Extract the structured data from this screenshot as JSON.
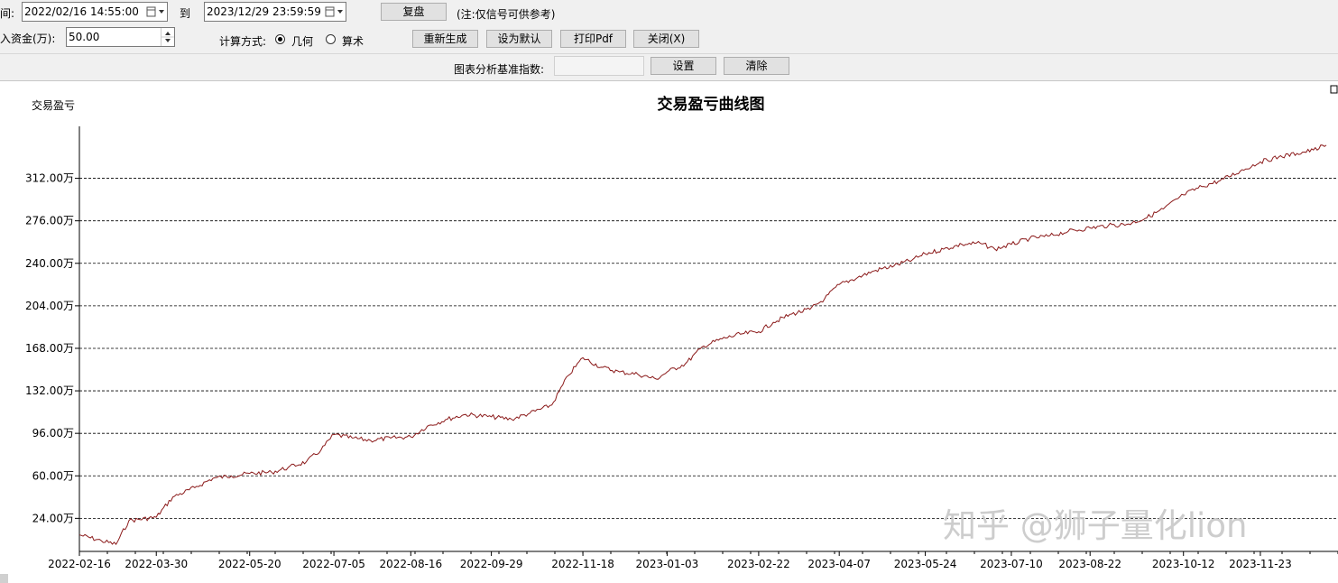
{
  "controls": {
    "time_label": "间:",
    "start_date": "2022/02/16 14:55:00",
    "to_label": "到",
    "end_date": "2023/12/29 23:59:59",
    "replay_button": "复盘",
    "note": "(注:仅信号可供参考)",
    "capital_label": "入资金(万):",
    "capital_value": "50.00",
    "calc_label": "计算方式:",
    "calc_options": [
      {
        "label": "几何",
        "selected": true
      },
      {
        "label": "算术",
        "selected": false
      }
    ],
    "regenerate_button": "重新生成",
    "set_default_button": "设为默认",
    "print_pdf_button": "打印Pdf",
    "close_button": "关闭(X)",
    "index_label": "图表分析基准指数:",
    "index_value": "",
    "set_button": "设置",
    "clear_button": "清除"
  },
  "watermark": "知乎 @狮子量化lion",
  "chart_data": {
    "type": "line",
    "title": "交易盈亏曲线图",
    "ylabel": "交易盈亏",
    "xlabel": "",
    "ylim": [
      -4,
      356
    ],
    "yticks": [
      24,
      60,
      96,
      132,
      168,
      204,
      240,
      276,
      312
    ],
    "ytick_labels": [
      "24.00万",
      "60.00万",
      "96.00万",
      "132.00万",
      "168.00万",
      "204.00万",
      "240.00万",
      "276.00万",
      "312.00万"
    ],
    "xticks": [
      "2022-02-16",
      "2022-03-30",
      "2022-05-20",
      "2022-07-05",
      "2022-08-16",
      "2022-09-29",
      "2022-11-18",
      "2023-01-03",
      "2023-02-22",
      "2023-04-07",
      "2023-05-24",
      "2023-07-10",
      "2023-08-22",
      "2023-10-12",
      "2023-11-23"
    ],
    "grid": true,
    "line_color": "#8b1a1a",
    "series": [
      {
        "x": [
          "2022-02-16",
          "2022-02-28",
          "2022-03-08",
          "2022-03-15",
          "2022-03-30",
          "2022-04-08",
          "2022-04-20",
          "2022-04-30",
          "2022-05-10",
          "2022-05-20",
          "2022-06-01",
          "2022-06-10",
          "2022-06-20",
          "2022-06-28",
          "2022-07-05",
          "2022-07-15",
          "2022-07-25",
          "2022-08-05",
          "2022-08-16",
          "2022-08-25",
          "2022-09-05",
          "2022-09-15",
          "2022-09-29",
          "2022-10-10",
          "2022-10-20",
          "2022-11-01",
          "2022-11-10",
          "2022-11-18",
          "2022-11-28",
          "2022-12-08",
          "2022-12-18",
          "2022-12-28",
          "2023-01-03",
          "2023-01-13",
          "2023-01-23",
          "2023-02-02",
          "2023-02-12",
          "2023-02-22",
          "2023-03-02",
          "2023-03-12",
          "2023-03-22",
          "2023-03-30",
          "2023-04-07",
          "2023-04-17",
          "2023-04-27",
          "2023-05-07",
          "2023-05-17",
          "2023-05-24",
          "2023-06-03",
          "2023-06-13",
          "2023-06-23",
          "2023-07-01",
          "2023-07-10",
          "2023-07-20",
          "2023-07-30",
          "2023-08-10",
          "2023-08-22",
          "2023-09-01",
          "2023-09-11",
          "2023-09-21",
          "2023-10-01",
          "2023-10-12",
          "2023-10-22",
          "2023-11-01",
          "2023-11-12",
          "2023-11-23",
          "2023-12-03",
          "2023-12-13",
          "2023-12-22",
          "2023-12-29"
        ],
        "values": [
          10,
          5,
          2,
          22,
          25,
          42,
          50,
          58,
          60,
          62,
          63,
          67,
          72,
          82,
          95,
          92,
          90,
          92,
          93,
          102,
          108,
          112,
          110,
          108,
          113,
          120,
          145,
          160,
          152,
          148,
          146,
          142,
          148,
          155,
          170,
          176,
          180,
          182,
          190,
          197,
          201,
          210,
          222,
          228,
          234,
          238,
          243,
          248,
          252,
          256,
          257,
          252,
          256,
          261,
          263,
          267,
          270,
          272,
          273,
          278,
          286,
          298,
          305,
          310,
          318,
          326,
          330,
          333,
          336,
          340
        ]
      }
    ]
  }
}
